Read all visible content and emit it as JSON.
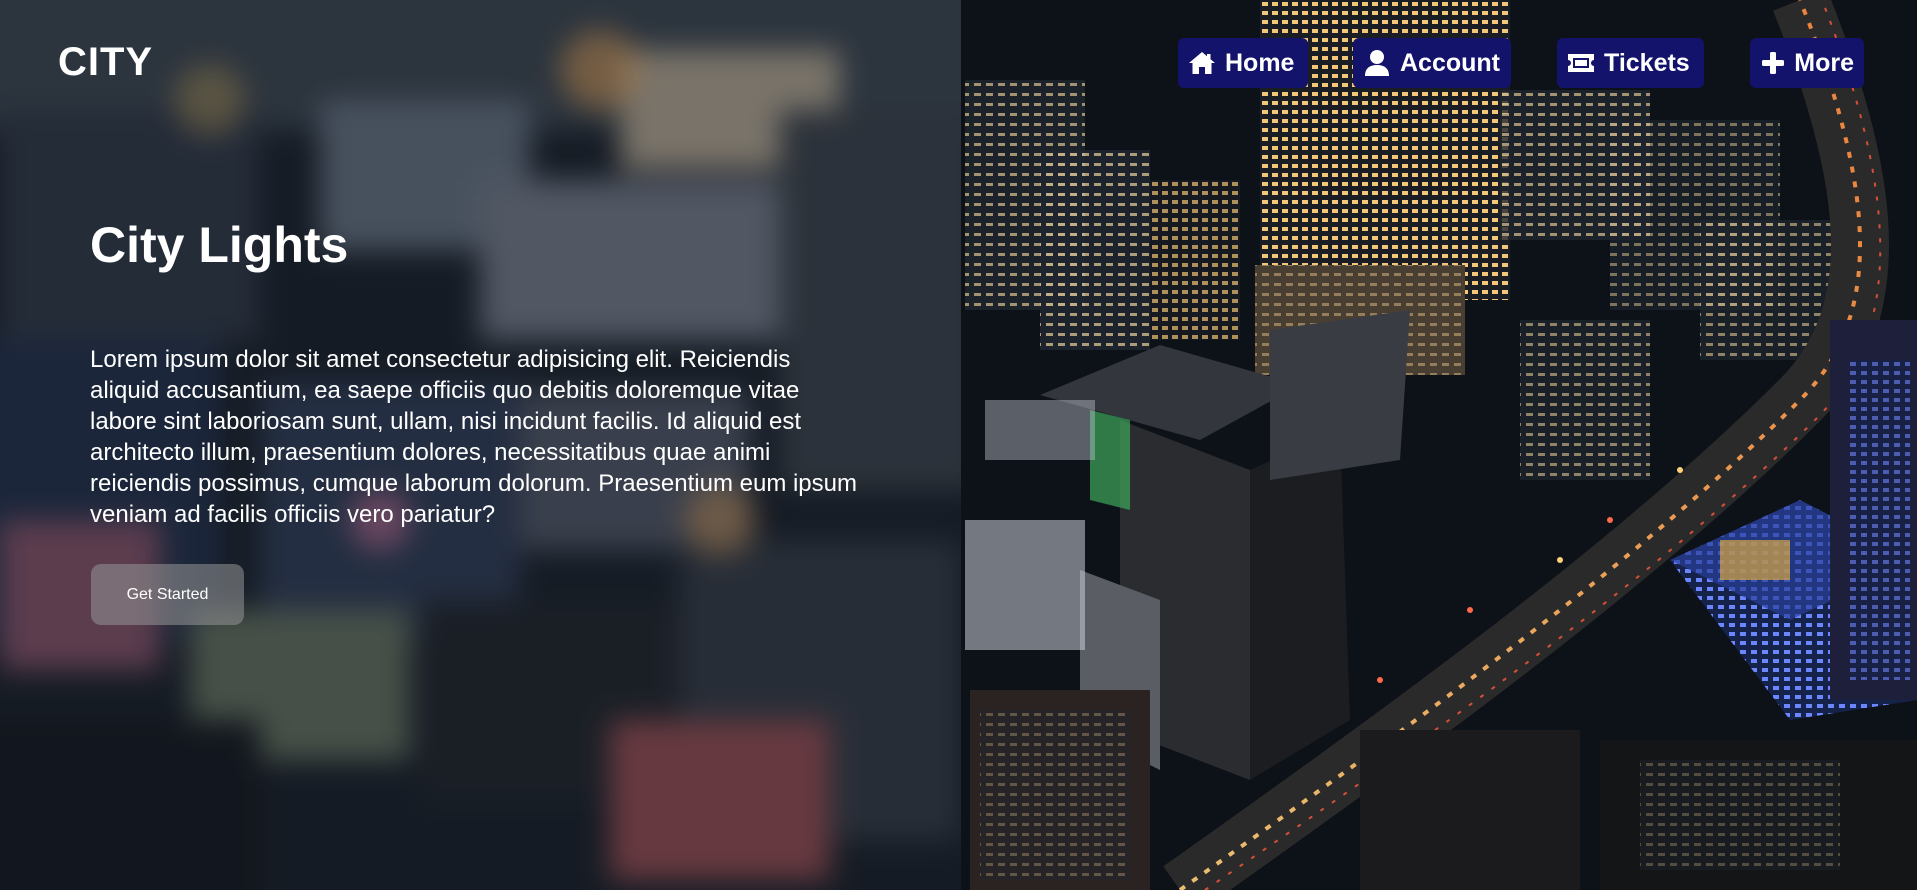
{
  "brand": {
    "logo": "CITY"
  },
  "nav": {
    "items": [
      {
        "label": "Home",
        "icon": "home-icon"
      },
      {
        "label": "Account",
        "icon": "user-icon"
      },
      {
        "label": "Tickets",
        "icon": "ticket-icon"
      },
      {
        "label": "More",
        "icon": "plus-icon"
      }
    ],
    "background_color": "#13136b"
  },
  "hero": {
    "title": "City Lights",
    "text": "Lorem ipsum dolor sit amet consectetur adipisicing elit. Reiciendis aliquid accusantium, ea saepe officiis quo debitis doloremque vitae labore sint laboriosam sunt, ullam, nisi incidunt facilis. Id aliquid est architecto illum, praesentium dolores, necessitatibus quae animi reiciendis possimus, cumque laborum dolorum. Praesentium eum ipsum veniam ad facilis officiis vero pariatur?",
    "cta_label": "Get Started"
  }
}
